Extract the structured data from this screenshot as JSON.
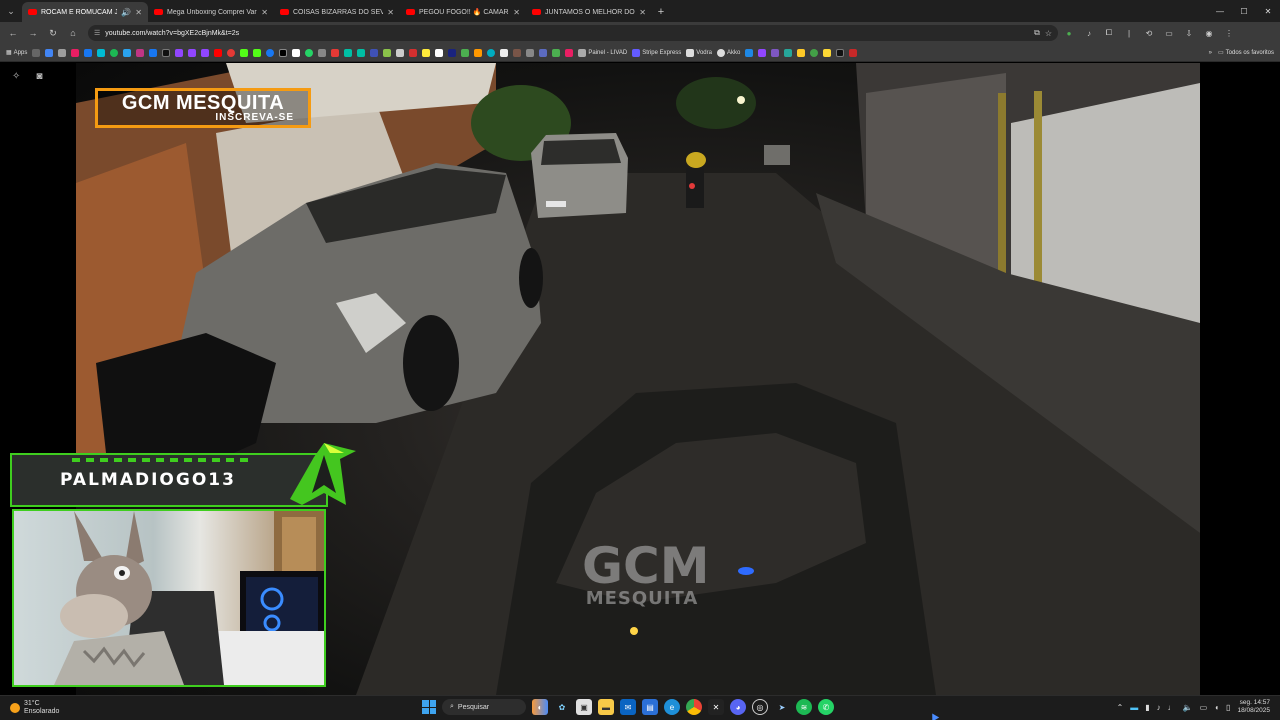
{
  "browser": {
    "tabs": [
      {
        "title": "ROCAM E ROMUCAM JUN",
        "active": true
      },
      {
        "title": "Mega Unboxing Comprei Vario",
        "active": false
      },
      {
        "title": "COISAS BIZARRAS DO SEVEN E",
        "active": false
      },
      {
        "title": "PEGOU FOGO!! 🔥 CAMARIM",
        "active": false
      },
      {
        "title": "JUNTAMOS O MELHOR DO BC",
        "active": false
      }
    ],
    "url": "youtube.com/watch?v=bgXE2cBjnMk&t=2s",
    "bookmarks": {
      "apps_label": "Apps",
      "named": [
        "Painel - LIVAD",
        "Stripe Express",
        "Vodra",
        "Akko"
      ],
      "all_favorites": "Todos os favoritos"
    }
  },
  "video": {
    "channel_name": "GCM MESQUITA",
    "channel_cta": "INSCREVA-SE",
    "watermark_line1": "GCM",
    "watermark_line2": "MESQUITA"
  },
  "stream_overlay": {
    "streamer_name": "PALMADIOGO13",
    "accent_color": "#3fce1f"
  },
  "taskbar": {
    "weather_temp": "31°C",
    "weather_desc": "Ensolarado",
    "search_label": "Pesquisar",
    "time": "14:57",
    "day": "seg.",
    "date": "18/08/2025"
  }
}
